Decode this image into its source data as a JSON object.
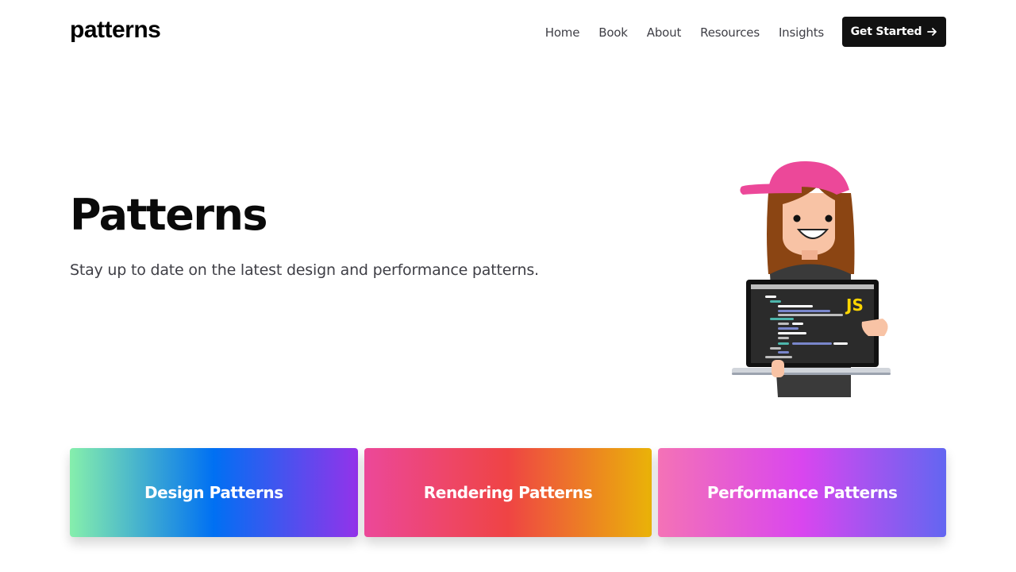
{
  "header": {
    "logo": "patterns",
    "nav": [
      "Home",
      "Book",
      "About",
      "Resources",
      "Insights"
    ],
    "cta_label": "Get Started",
    "cta_icon": "arrow-right-icon"
  },
  "hero": {
    "title": "Patterns",
    "subtitle": "Stay up to date on the latest design and performance patterns.",
    "illustration_badge": "JS"
  },
  "cards": [
    {
      "label": "Design Patterns",
      "colors": [
        "#86efac",
        "#0070f3",
        "#9333ea"
      ]
    },
    {
      "label": "Rendering Patterns",
      "colors": [
        "#ec4899",
        "#ef4444",
        "#eab308"
      ]
    },
    {
      "label": "Performance Patterns",
      "colors": [
        "#f472b6",
        "#d946ef",
        "#6366f1"
      ]
    }
  ],
  "colors": {
    "cta_background": "#111111",
    "nav_text": "#3f3f46",
    "title_text": "#0a0a0a"
  }
}
